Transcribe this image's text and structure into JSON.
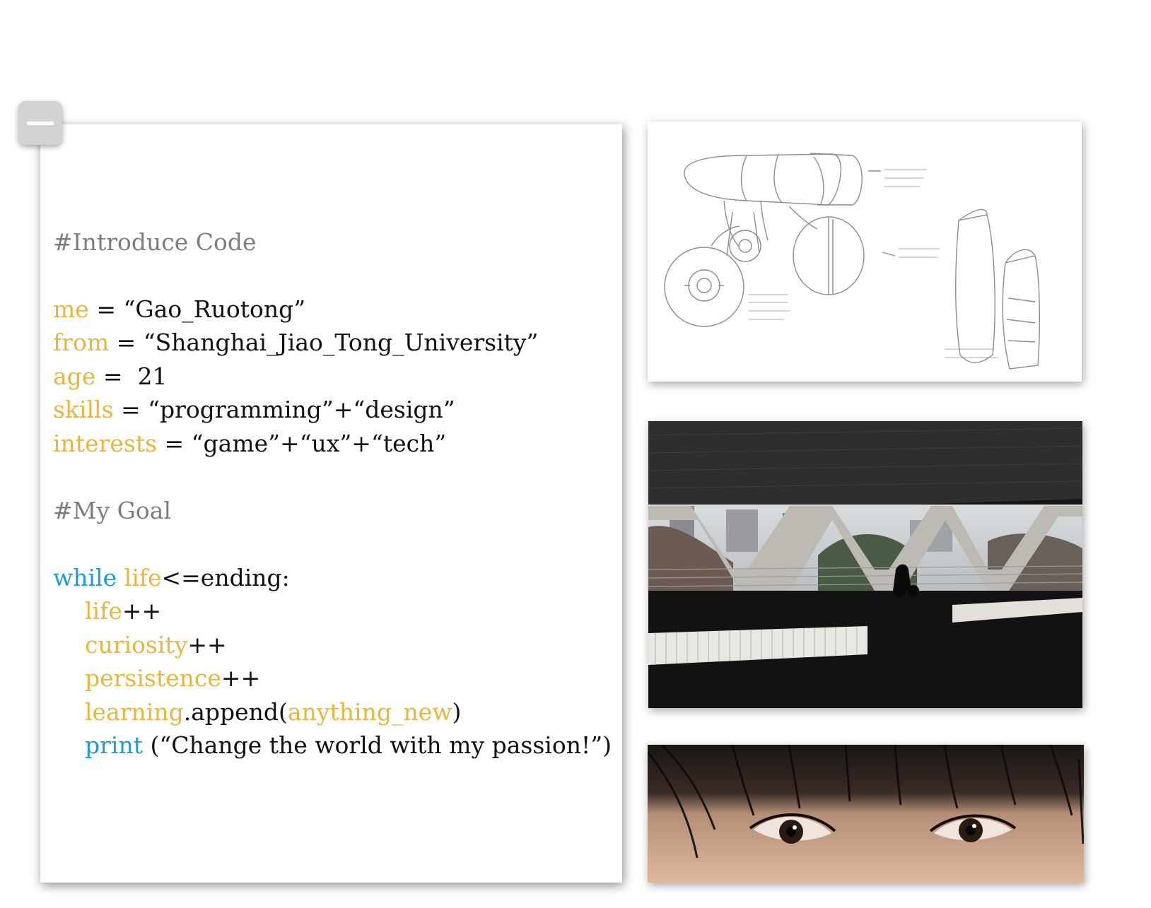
{
  "code": {
    "intro_comment": "#Introduce Code",
    "me_var": "me",
    "me_value": " = “Gao_Ruotong”",
    "from_var": "from",
    "from_value": " = “Shanghai_Jiao_Tong_University”",
    "age_var": "age",
    "age_value": " =  21",
    "skills_var": "skills",
    "skills_value": " = “programming”+“design”",
    "interests_var": "interests",
    "interests_value": " = “game”+“ux”+“tech”",
    "goal_comment": "#My Goal",
    "while_kw": "while",
    "life_var": "life",
    "while_rest": "<=ending:",
    "life_inc_var": "life",
    "inc": "++",
    "curiosity_var": "curiosity",
    "persistence_var": "persistence",
    "learning_var": "learning",
    "append_text": ".append(",
    "anything_new": "anything_new",
    "close_paren": ")",
    "print_kw": "print",
    "print_rest": " (“Change the world with my passion!”)"
  },
  "colors": {
    "comment": "#7d7d7d",
    "variable": "#e8b63e",
    "keyword": "#1e9bd7",
    "text": "#111111"
  },
  "icons": {
    "minimize": "minus-icon"
  }
}
